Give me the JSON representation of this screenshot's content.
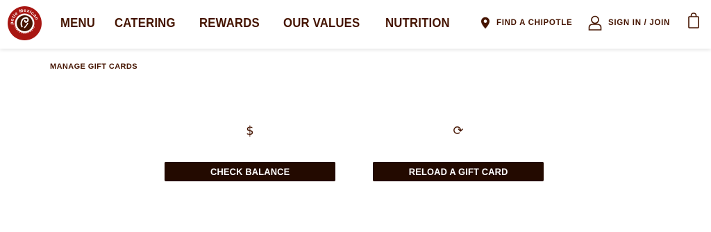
{
  "header": {
    "logo": {
      "alt": "Chipotle Mexican Grill",
      "brand_color": "#a81612"
    },
    "nav": [
      "MENU",
      "CATERING",
      "REWARDS",
      "OUR VALUES",
      "NUTRITION"
    ],
    "find": {
      "label": "FIND A CHIPOTLE",
      "icon": "map-pin-icon"
    },
    "sign_in": {
      "label": "SIGN IN / JOIN",
      "icon": "user-icon"
    },
    "bag": {
      "icon": "shopping-bag-icon"
    }
  },
  "main": {
    "breadcrumb": "MANAGE GIFT CARDS",
    "cards": [
      {
        "icon_glyph": "$",
        "icon": "dollar-icon",
        "button": "CHECK BALANCE"
      },
      {
        "icon_glyph": "⟳",
        "icon": "reload-icon",
        "button": "RELOAD A GIFT CARD"
      }
    ]
  },
  "colors": {
    "text": "#451400",
    "button_bg": "#230a00",
    "button_text": "#ffffff"
  }
}
